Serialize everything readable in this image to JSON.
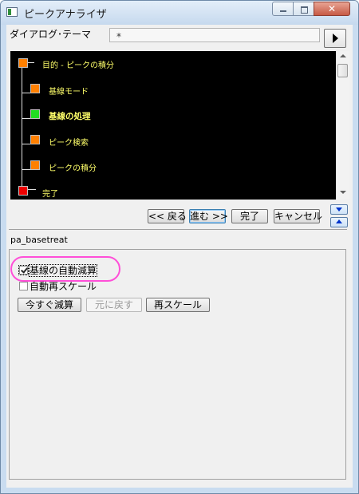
{
  "window": {
    "title": "ピークアナライザ",
    "close_glyph": "✕"
  },
  "theme": {
    "label": "ダイアログ･テーマ",
    "value": "*"
  },
  "tree": {
    "nodes": [
      {
        "label": "目的 - ピークの積分",
        "color": "#ff8000"
      },
      {
        "label": "基線モード",
        "color": "#ff8000"
      },
      {
        "label": "基線の処理",
        "color": "#22dd22",
        "current": true
      },
      {
        "label": "ピーク検索",
        "color": "#ff8000"
      },
      {
        "label": "ピークの積分",
        "color": "#ff8000"
      },
      {
        "label": "完了",
        "color": "#ee0000"
      }
    ]
  },
  "nav": {
    "back": "<< 戻る",
    "next": "進む >>",
    "finish": "完了",
    "cancel": "キャンセル"
  },
  "page_name": "pa_basetreat",
  "options": {
    "auto_subtract": {
      "label": "基線の自動減算",
      "checked": true
    },
    "auto_rescale": {
      "label": "自動再スケール",
      "checked": false
    }
  },
  "actions": {
    "subtract_now": "今すぐ減算",
    "undo": "元に戻す",
    "rescale": "再スケール"
  },
  "colors": {
    "title_bar": "#c9dcf0",
    "tree_bg": "#000000",
    "tree_text": "#ffff6a",
    "highlight": "#ff4fd8"
  }
}
